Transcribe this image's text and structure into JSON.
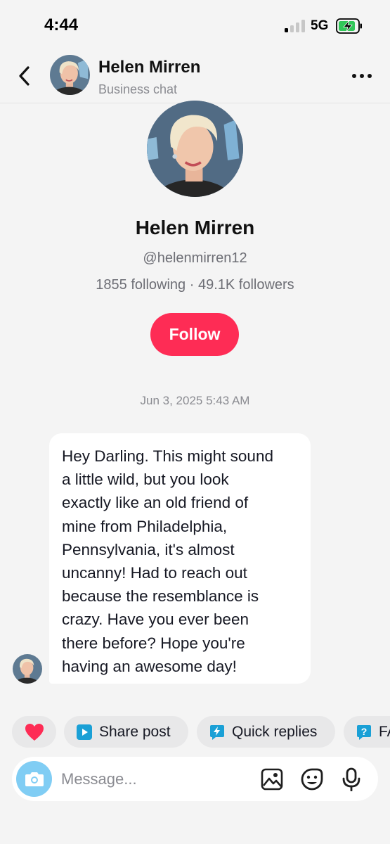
{
  "status_bar": {
    "time": "4:44",
    "network": "5G"
  },
  "header": {
    "name": "Helen Mirren",
    "subtitle": "Business chat"
  },
  "profile": {
    "name": "Helen Mirren",
    "handle": "@helenmirren12",
    "stats": "1855 following · 49.1K followers",
    "follow_label": "Follow"
  },
  "conversation": {
    "timestamp": "Jun 3, 2025 5:43 AM",
    "message_lines": [
      "Hey Darling. This might sound",
      "a little wild, but you look",
      "exactly like an old friend of",
      "mine from Philadelphia,",
      "Pennsylvania, it's almost",
      "uncanny! Had to reach out",
      "because the resemblance is",
      "crazy. Have you ever been",
      "there before? Hope you're",
      "having an awesome day!"
    ]
  },
  "quick_actions": {
    "heart_icon": "heart-icon",
    "share_post": "Share post",
    "quick_replies": "Quick replies",
    "faq": "FAQ"
  },
  "composer": {
    "placeholder": "Message..."
  },
  "colors": {
    "follow": "#fe2c55",
    "camera": "#80cdf4",
    "heart": "#fe2c55",
    "chip_icon": "#1aa0d6",
    "battery_fill": "#31c759"
  }
}
